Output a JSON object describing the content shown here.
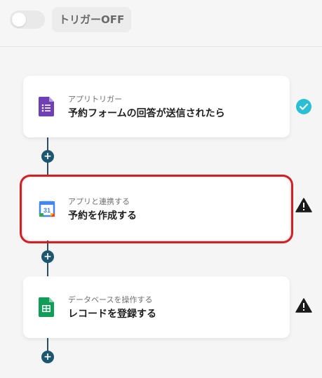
{
  "trigger_toggle": {
    "label": "トリガーOFF",
    "state": "off"
  },
  "steps": [
    {
      "subtitle": "アプリトリガー",
      "title": "予約フォームの回答が送信されたら",
      "app_icon": "google-forms-icon",
      "status": "complete",
      "status_icon": "check-circle-icon",
      "status_color": "#2bbfd4"
    },
    {
      "subtitle": "アプリと連携する",
      "title": "予約を作成する",
      "app_icon": "google-calendar-icon",
      "status": "warning",
      "status_icon": "warning-triangle-icon",
      "selected": true
    },
    {
      "subtitle": "データベースを操作する",
      "title": "レコードを登録する",
      "app_icon": "google-sheets-icon",
      "status": "warning",
      "status_icon": "warning-triangle-icon"
    }
  ],
  "add_step_button": "+",
  "colors": {
    "accent": "#1d5670",
    "selection_outline": "#d21f24",
    "check": "#2bbfd4"
  }
}
